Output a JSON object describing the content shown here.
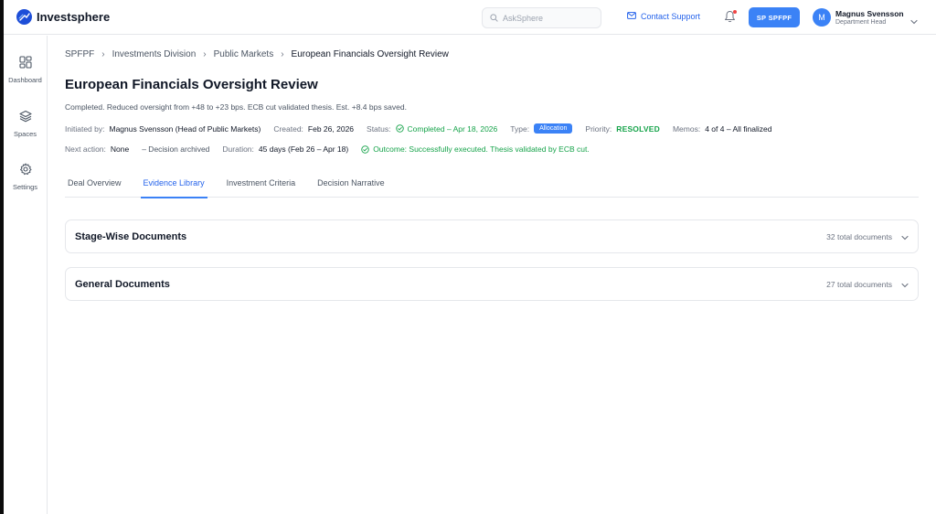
{
  "app": {
    "name": "Investsphere"
  },
  "header": {
    "search_placeholder": "AskSphere",
    "contact_label": "Contact Support",
    "org_button": "SP  SPFPF",
    "user": {
      "initial": "M",
      "name": "Magnus Svensson",
      "role": "Department Head"
    }
  },
  "sidebar": {
    "items": [
      {
        "label": "Dashboard",
        "icon": "dashboard-icon"
      },
      {
        "label": "Spaces",
        "icon": "layers-icon"
      },
      {
        "label": "Settings",
        "icon": "gear-icon"
      }
    ]
  },
  "breadcrumb": [
    "SPFPF",
    "Investments Division",
    "Public Markets",
    "European Financials Oversight Review"
  ],
  "page": {
    "title": "European Financials Oversight Review",
    "summary": "Completed. Reduced oversight from +48 to +23 bps. ECB cut validated thesis. Est. +8.4 bps saved.",
    "initiated_by_label": "Initiated by:",
    "initiated_by": "Magnus Svensson (Head of Public Markets)",
    "created_label": "Created:",
    "created": "Feb 26, 2026",
    "status_label": "Status:",
    "status": "Completed – Apr 18, 2026",
    "type_label": "Type:",
    "type": "Allocation",
    "priority_label": "Priority:",
    "priority": "RESOLVED",
    "memos_label": "Memos:",
    "memos": "4 of 4 – All finalized",
    "next_action_label": "Next action:",
    "next_action": "None",
    "decision_note": "– Decision archived",
    "duration_label": "Duration:",
    "duration": "45 days (Feb 26 – Apr 18)",
    "outcome": "Outcome: Successfully executed. Thesis validated by ECB cut."
  },
  "tabs": [
    {
      "label": "Deal Overview",
      "active": false
    },
    {
      "label": "Evidence Library",
      "active": true
    },
    {
      "label": "Investment Criteria",
      "active": false
    },
    {
      "label": "Decision Narrative",
      "active": false
    }
  ],
  "sections": [
    {
      "title": "Stage-Wise Documents",
      "count": "32 total documents"
    },
    {
      "title": "General Documents",
      "count": "27 total documents"
    }
  ],
  "colors": {
    "accent": "#3b82f6",
    "link": "#2563eb",
    "success": "#16a34a",
    "notification": "#ef4444"
  }
}
